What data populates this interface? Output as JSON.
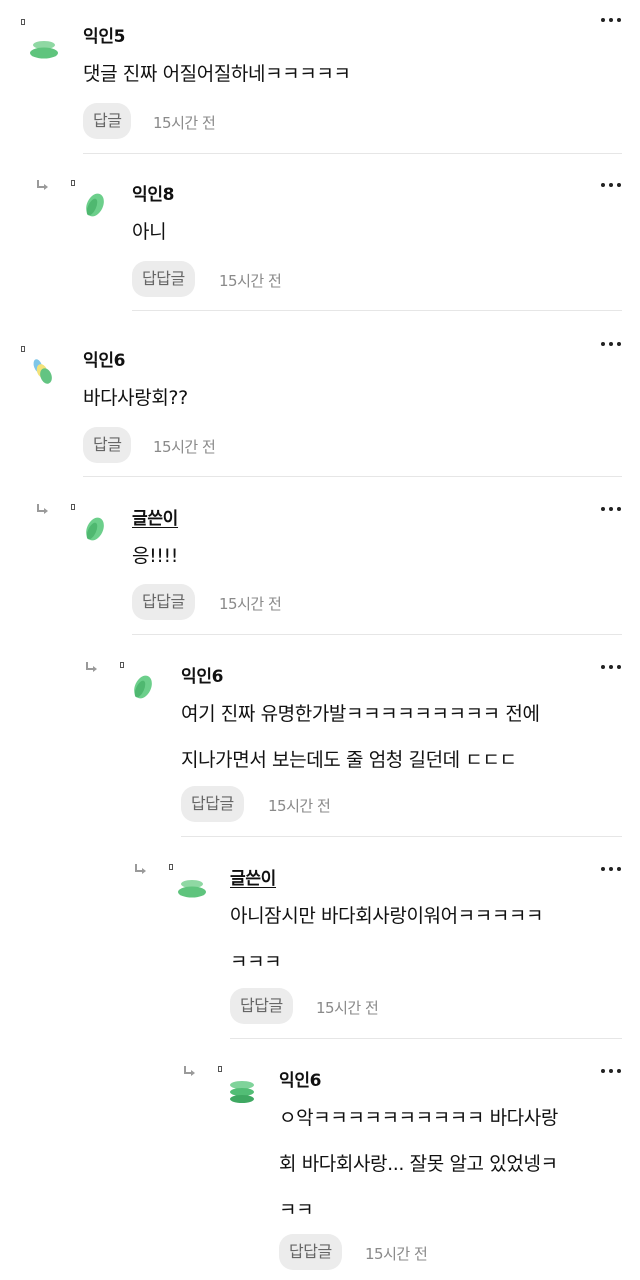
{
  "comments": [
    {
      "author": "익인5",
      "lines": [
        "댓글 진짜 어질어질하네ㅋㅋㅋㅋㅋ"
      ],
      "reply_label": "답글",
      "time": "15시간 전",
      "avatar": "green-stack-icon"
    },
    {
      "author": "익인8",
      "lines": [
        "아니"
      ],
      "reply_label": "답답글",
      "time": "15시간 전",
      "avatar": "green-leaf-icon"
    },
    {
      "author": "익인6",
      "lines": [
        "바다사랑회??"
      ],
      "reply_label": "답글",
      "time": "15시간 전",
      "avatar": "multicolor-leaf-icon"
    },
    {
      "author": "글쓴이",
      "lines": [
        "응!!!!"
      ],
      "reply_label": "답답글",
      "time": "15시간 전",
      "avatar": "green-leaf-icon"
    },
    {
      "author": "익인6",
      "lines": [
        "여기 진짜 유명한가발ㅋㅋㅋㅋㅋㅋㅋㅋㅋ 전에",
        "지나가면서 보는데도 줄 엄청 길던데 ㄷㄷㄷ"
      ],
      "reply_label": "답답글",
      "time": "15시간 전",
      "avatar": "green-leaf-icon"
    },
    {
      "author": "글쓴이",
      "lines": [
        "아니잠시만 바다회사랑이워어ㅋㅋㅋㅋㅋ",
        "ㅋㅋㅋ"
      ],
      "reply_label": "답답글",
      "time": "15시간 전",
      "avatar": "green-stack-icon"
    },
    {
      "author": "익인6",
      "lines": [
        "ㅇ악ㅋㅋㅋㅋㅋㅋㅋㅋㅋㅋ 바다사랑",
        "회 바다회사랑... 잘못 알고 있었넹ㅋ",
        "ㅋㅋ"
      ],
      "reply_label": "답답글",
      "time": "15시간 전",
      "avatar": "green-stripe-icon"
    }
  ]
}
